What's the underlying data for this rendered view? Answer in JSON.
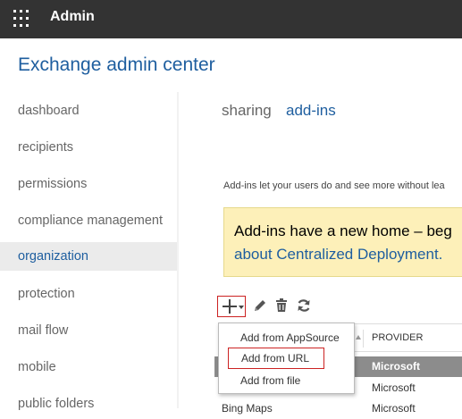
{
  "topbar": {
    "app_name": "Admin",
    "launcher_icon": "app-launcher-waffle-icon"
  },
  "header": {
    "title": "Exchange admin center"
  },
  "sidebar": {
    "items": [
      {
        "label": "dashboard"
      },
      {
        "label": "recipients"
      },
      {
        "label": "permissions"
      },
      {
        "label": "compliance management"
      },
      {
        "label": "organization",
        "active": true
      },
      {
        "label": "protection"
      },
      {
        "label": "mail flow"
      },
      {
        "label": "mobile"
      },
      {
        "label": "public folders"
      }
    ]
  },
  "tabs": [
    {
      "label": "sharing"
    },
    {
      "label": "add-ins",
      "active": true
    }
  ],
  "description": "Add-ins let your users do and see more without lea",
  "banner": {
    "line1": "Add-ins have a new home – beg",
    "line2": "about Centralized Deployment."
  },
  "toolbar": {
    "add_icon": "plus-icon",
    "edit_icon": "pencil-icon",
    "delete_icon": "trash-icon",
    "refresh_icon": "refresh-icon"
  },
  "add_menu": {
    "options": [
      {
        "label": "Add from AppSource"
      },
      {
        "label": "Add from URL",
        "highlighted": true
      },
      {
        "label": "Add from file"
      }
    ]
  },
  "table": {
    "columns": [
      "PROVIDER"
    ],
    "rows": [
      {
        "name": "",
        "provider": "Microsoft",
        "selected": true
      },
      {
        "name": "",
        "provider": "Microsoft"
      },
      {
        "name": "Bing Maps",
        "provider": "Microsoft"
      }
    ]
  },
  "colors": {
    "topbar_bg": "#333333",
    "accent": "#1e5e9f",
    "banner_bg": "#fdf0b9",
    "highlight_border": "#cc2222",
    "selected_row_bg": "#8c8c8c"
  }
}
